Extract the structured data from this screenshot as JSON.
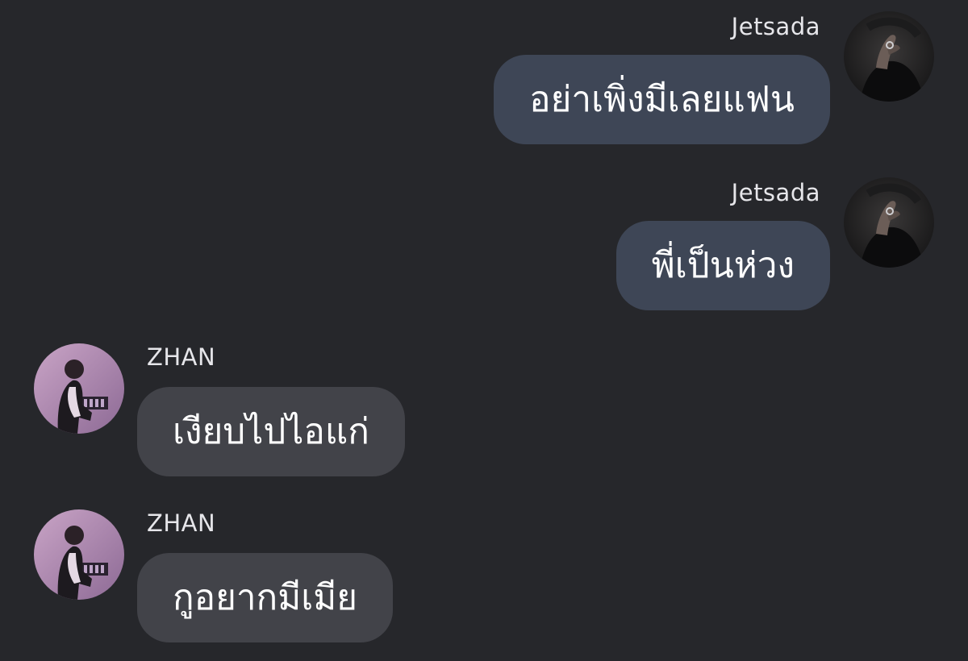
{
  "conversation": {
    "messages": [
      {
        "sender": "Jetsada",
        "text": "อย่าเพิ่งมีเลยแฟน",
        "direction": "outgoing"
      },
      {
        "sender": "Jetsada",
        "text": "พี่เป็นห่วง",
        "direction": "outgoing"
      },
      {
        "sender": "ZHAN",
        "text": "เงียบไปไอแก่",
        "direction": "incoming"
      },
      {
        "sender": "ZHAN",
        "text": "กูอยากมีเมีย",
        "direction": "incoming"
      }
    ]
  },
  "colors": {
    "background": "#26272b",
    "outgoing_bubble": "#3e4656",
    "incoming_bubble": "#424349",
    "sender_name": "#e6e6ea",
    "message_text": "#ffffff"
  }
}
